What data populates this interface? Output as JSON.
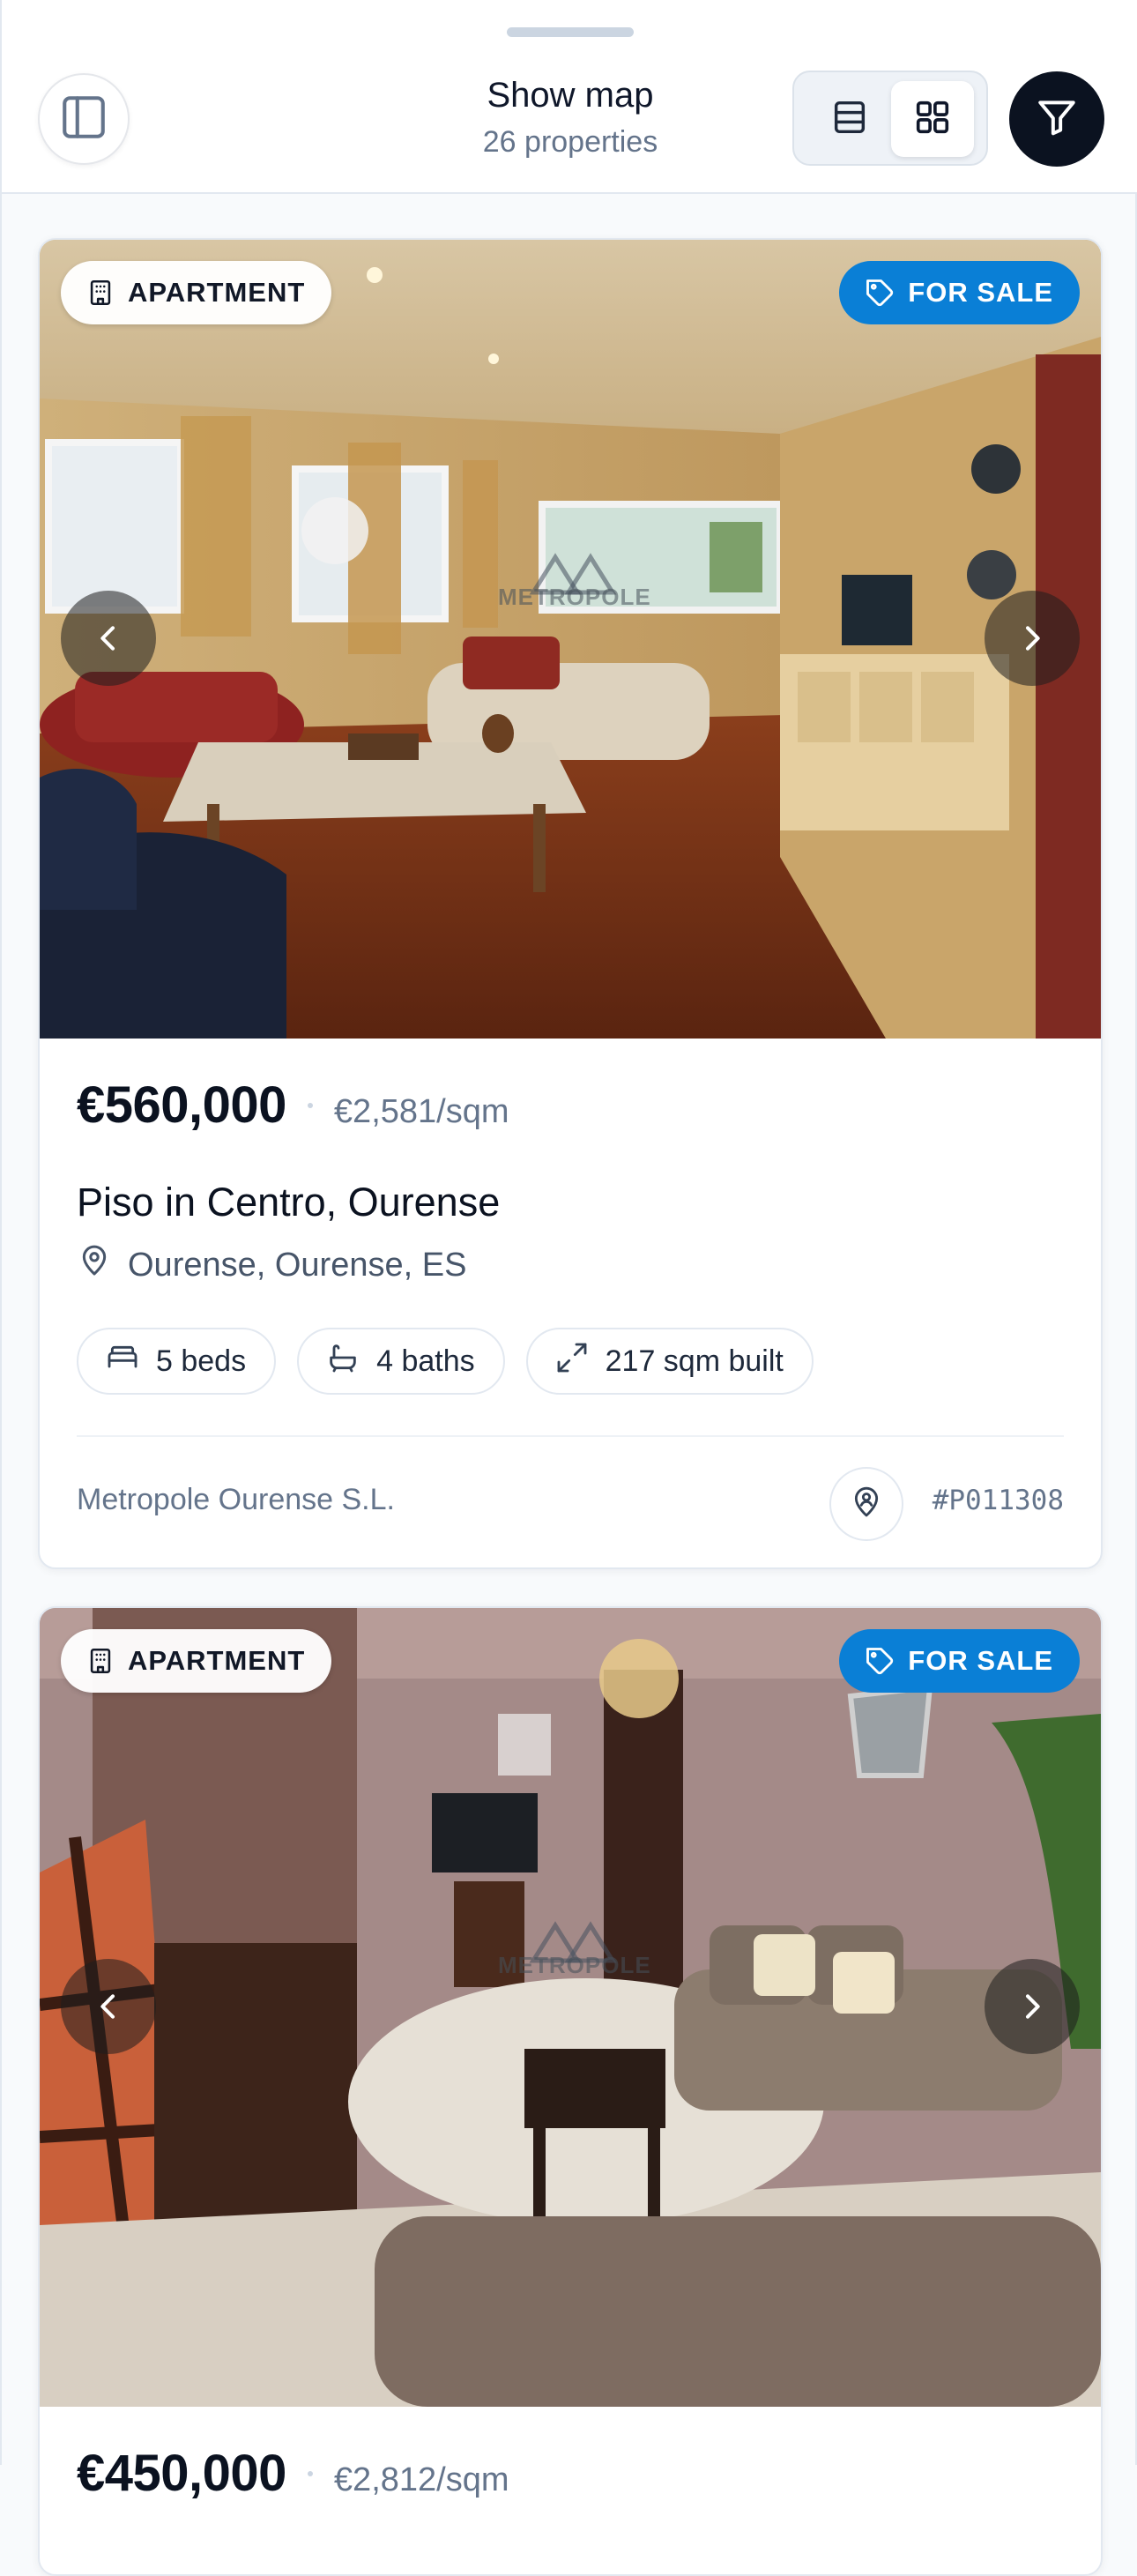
{
  "header": {
    "title": "Show map",
    "subtitle": "26 properties",
    "panel_icon": "sidebar-panel-icon",
    "view_options": [
      "list-view-icon",
      "grid-view-icon"
    ],
    "active_view": "grid",
    "filter_icon": "filter-funnel-icon"
  },
  "listings": [
    {
      "type_badge": "APARTMENT",
      "status_badge": "FOR SALE",
      "watermark": "METROPOLE",
      "price": "€560,000",
      "price_per_sqm": "€2,581/sqm",
      "title": "Piso in Centro, Ourense",
      "location": "Ourense, Ourense, ES",
      "features": [
        {
          "icon": "bed-icon",
          "label": "5 beds"
        },
        {
          "icon": "bath-icon",
          "label": "4 baths"
        },
        {
          "icon": "expand-icon",
          "label": "217 sqm built"
        }
      ],
      "agency": "Metropole Ourense S.L.",
      "reference": "#P011308"
    },
    {
      "type_badge": "APARTMENT",
      "status_badge": "FOR SALE",
      "watermark": "METROPOLE",
      "price": "€450,000",
      "price_per_sqm": "€2,812/sqm"
    }
  ],
  "colors": {
    "accent": "#0a7fd6",
    "filter_button": "#0b1220",
    "muted_text": "#64748b"
  }
}
